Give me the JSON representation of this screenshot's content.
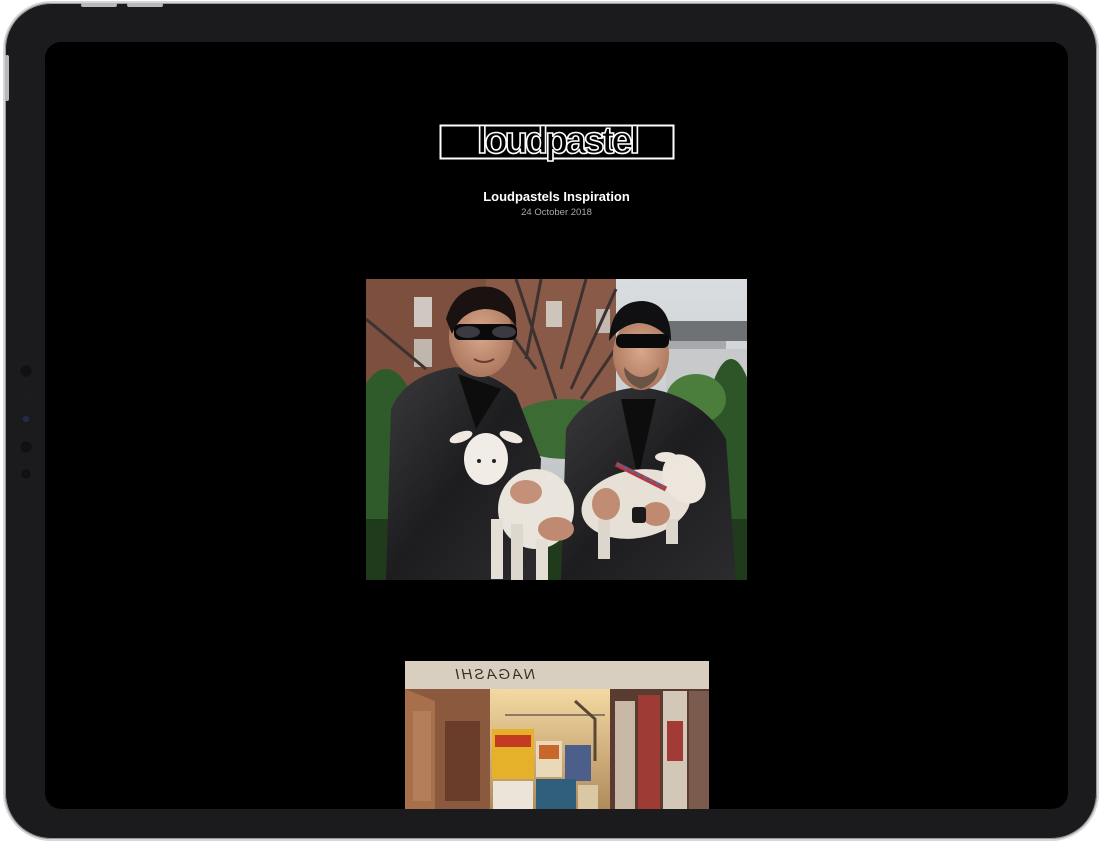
{
  "site": {
    "logo_text": "loudpastel"
  },
  "post": {
    "title": "Loudpastels Inspiration",
    "date": "24 October 2018"
  },
  "images": [
    {
      "name": "photo-two-men-with-lambs"
    },
    {
      "name": "photo-poster-alley"
    }
  ],
  "graffiti_text": "NAGASHI",
  "colors": {
    "screen_background": "#000000",
    "bezel": "#1b1b1d",
    "title_text": "#ffffff",
    "date_text": "#a8a8a8"
  }
}
